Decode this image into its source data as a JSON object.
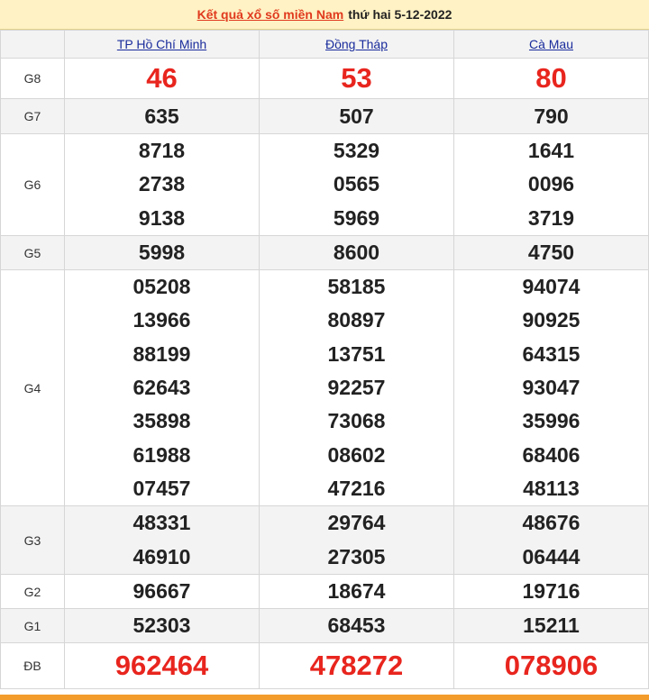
{
  "header": {
    "link_text": "Kết quả xổ số miền Nam",
    "rest_text": "thứ hai 5-12-2022"
  },
  "provinces": [
    "TP Hồ Chí Minh",
    "Đồng Tháp",
    "Cà Mau"
  ],
  "prizes": {
    "g8": {
      "label": "G8",
      "values": [
        "46",
        "53",
        "80"
      ]
    },
    "g7": {
      "label": "G7",
      "values": [
        "635",
        "507",
        "790"
      ]
    },
    "g6": {
      "label": "G6",
      "values": [
        [
          "8718",
          "2738",
          "9138"
        ],
        [
          "5329",
          "0565",
          "5969"
        ],
        [
          "1641",
          "0096",
          "3719"
        ]
      ]
    },
    "g5": {
      "label": "G5",
      "values": [
        "5998",
        "8600",
        "4750"
      ]
    },
    "g4": {
      "label": "G4",
      "values": [
        [
          "05208",
          "13966",
          "88199",
          "62643",
          "35898",
          "61988",
          "07457"
        ],
        [
          "58185",
          "80897",
          "13751",
          "92257",
          "73068",
          "08602",
          "47216"
        ],
        [
          "94074",
          "90925",
          "64315",
          "93047",
          "35996",
          "68406",
          "48113"
        ]
      ]
    },
    "g3": {
      "label": "G3",
      "values": [
        [
          "48331",
          "46910"
        ],
        [
          "29764",
          "27305"
        ],
        [
          "48676",
          "06444"
        ]
      ]
    },
    "g2": {
      "label": "G2",
      "values": [
        "96667",
        "18674",
        "19716"
      ]
    },
    "g1": {
      "label": "G1",
      "values": [
        "52303",
        "68453",
        "15211"
      ]
    },
    "db": {
      "label": "ĐB",
      "values": [
        "962464",
        "478272",
        "078906"
      ]
    }
  },
  "colors": {
    "header_bg": "#fff2c4",
    "link": "#e03a1e",
    "special": "#e8251e",
    "province_link": "#1a2c9c",
    "alt_row": "#f3f3f3"
  }
}
